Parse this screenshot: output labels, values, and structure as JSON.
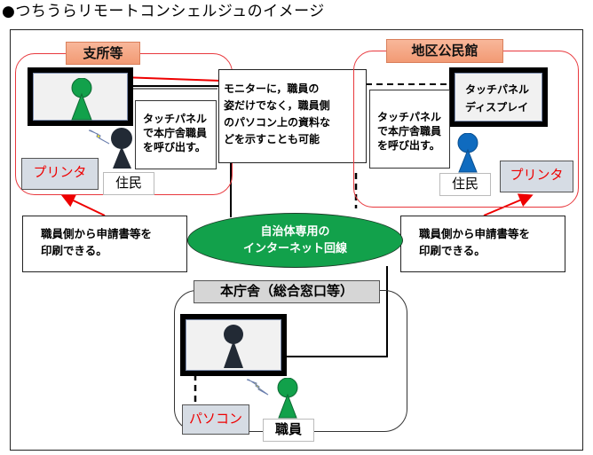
{
  "title": "●つちうらリモートコンシェルジュのイメージ",
  "sites": {
    "branch": {
      "tag": "支所等",
      "touch_note": [
        "タッチパネル",
        "で本庁舎職員",
        "を呼び出す。"
      ],
      "resident_label": "住民",
      "printer_label": "プリンタ"
    },
    "community": {
      "tag": "地区公民館",
      "display_label": [
        "タッチパネル",
        "ディスプレイ"
      ],
      "touch_note": [
        "タッチパネル",
        "で本庁舎職員",
        "を呼び出す。"
      ],
      "resident_label": "住民",
      "printer_label": "プリンタ"
    },
    "headquarters": {
      "tag": "本庁舎（総合窓口等）",
      "pc_label": "パソコン",
      "staff_label": "職員"
    }
  },
  "callouts": {
    "monitor_note": [
      "モニターに，職員の",
      "姿だけでなく，職員側",
      "のパソコン上の資料な",
      "どを示すことも可能"
    ],
    "print_note_left": [
      "職員側から申請書等を",
      "印刷できる。"
    ],
    "print_note_right": [
      "職員側から申請書等を",
      "印刷できる。"
    ]
  },
  "network": {
    "label": [
      "自治体専用の",
      "インターネット回線"
    ]
  },
  "colors": {
    "site_border": "#e8383d",
    "tag_fill": "#f4a47f",
    "network_fill": "#12a14b",
    "printer_text": "#ee0000",
    "staff_figure": "#12a14b",
    "resident_dark": "#222a35",
    "resident_blue": "#0f6bbf",
    "bolt": "#ffee22"
  }
}
